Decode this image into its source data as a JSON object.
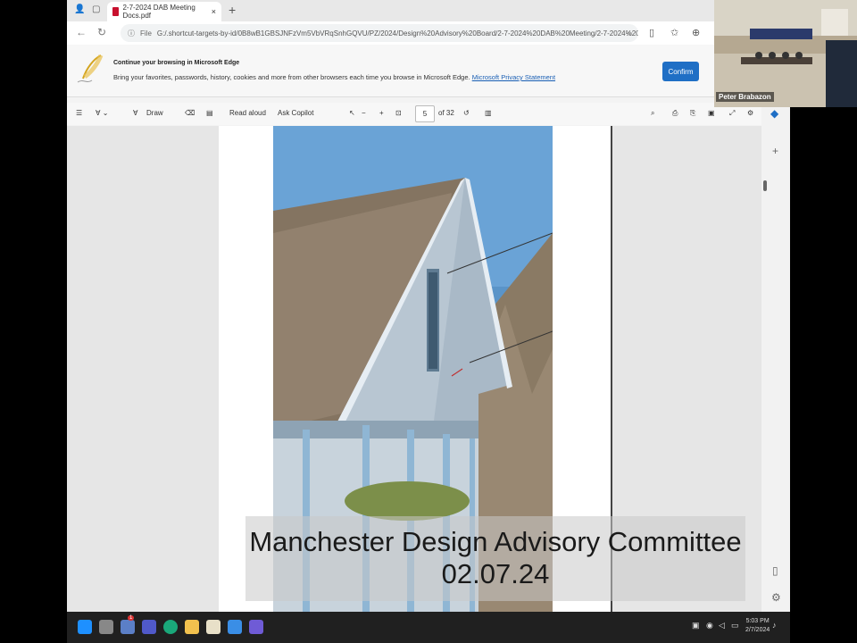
{
  "browser": {
    "tab_title": "2-7-2024 DAB Meeting Docs.pdf",
    "tab_close": "×",
    "new_tab": "+",
    "address_prefix": "File",
    "address_url": "G:/.shortcut-targets-by-id/0B8wB1GBSJNFzVm5VbVRqSnhGQVU/PZ/2024/Design%20Advisory%20Board/2-7-2024%20DAB%20Meeting/2-7-2024%20D..."
  },
  "banner": {
    "title": "Continue your browsing in Microsoft Edge",
    "text": "Bring your favorites, passwords, history, cookies and more from other browsers each time you browse in Microsoft Edge.",
    "link": "Microsoft Privacy Statement",
    "confirm": "Confirm"
  },
  "pdf_toolbar": {
    "draw": "Draw",
    "read_aloud": "Read aloud",
    "ask_copilot": "Ask Copilot",
    "page_current": "5",
    "page_total": "of 32"
  },
  "video": {
    "participant_name": "Peter Brabazon"
  },
  "caption": {
    "line1": "Manchester Design Advisory Committee",
    "line2": "02.07.24"
  },
  "taskbar": {
    "time": "5:03 PM",
    "date": "2/7/2024",
    "badge": "1"
  },
  "colors": {
    "accent": "#1f6fc5",
    "pdf_red": "#c8102e",
    "taskbar": "#202020"
  }
}
